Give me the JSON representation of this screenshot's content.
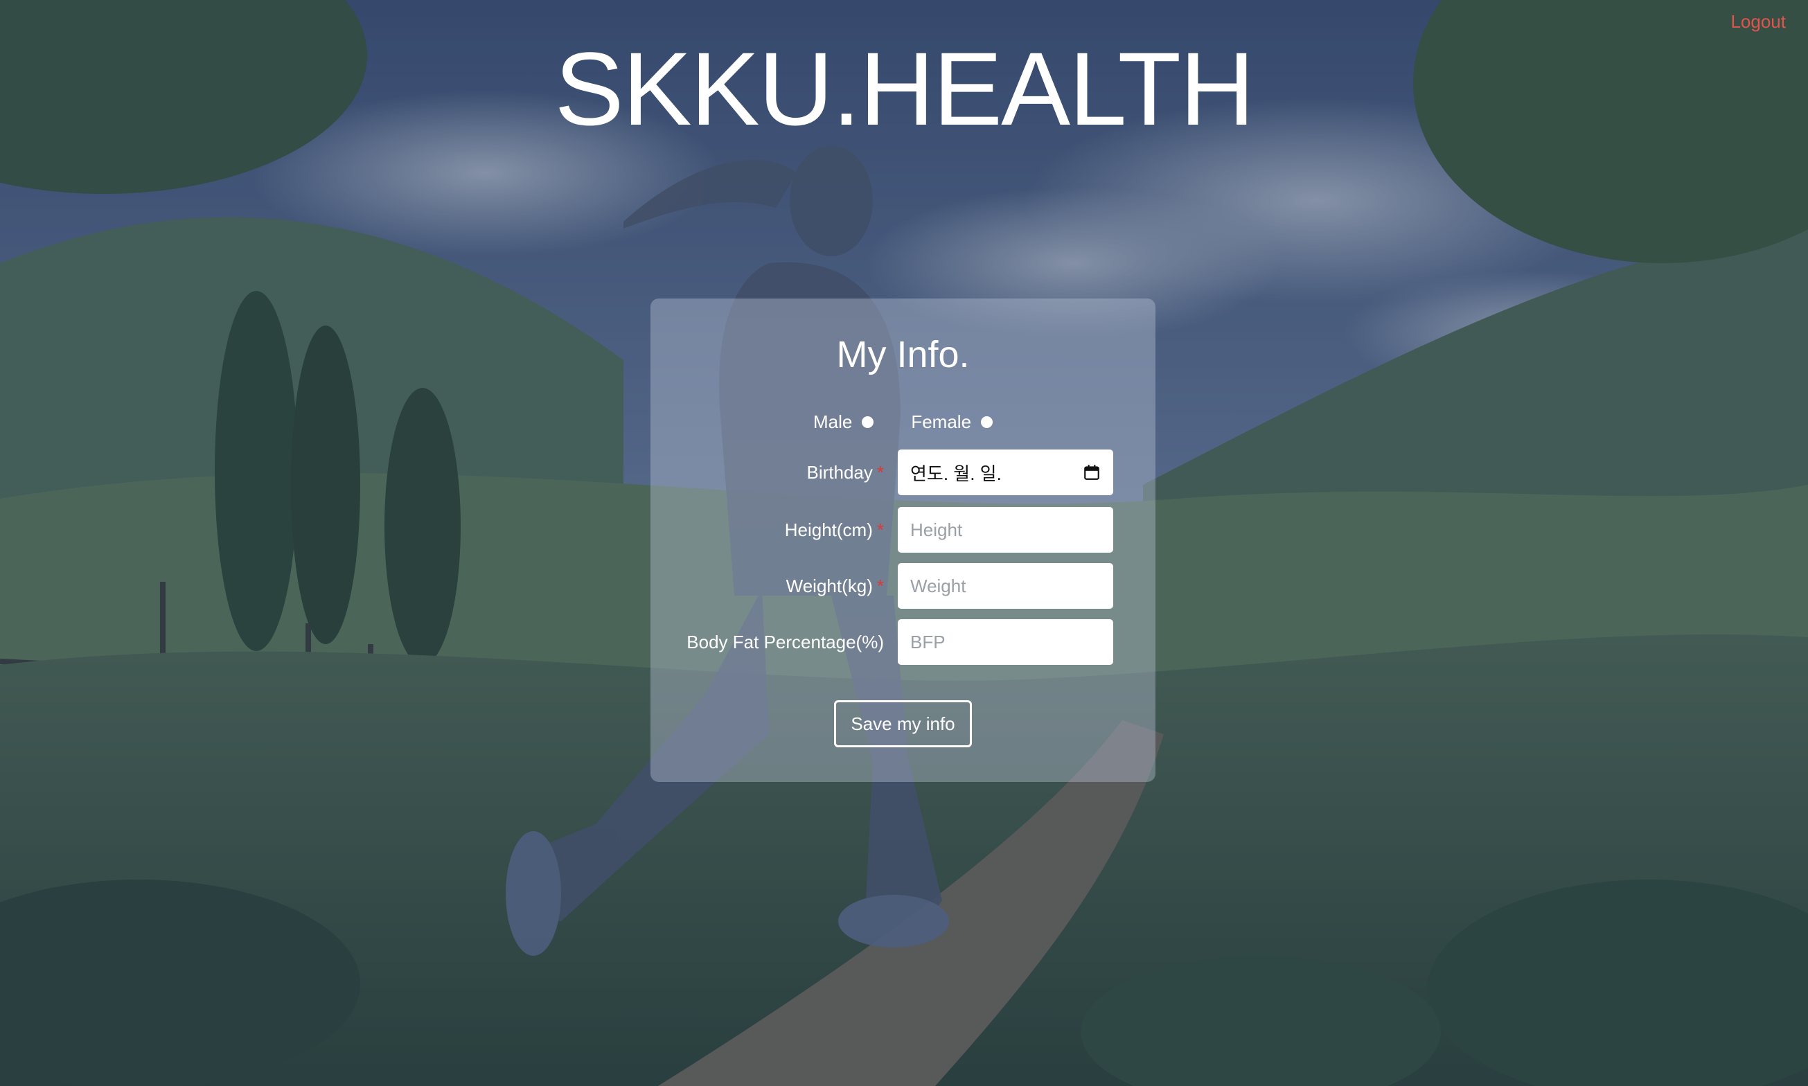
{
  "header": {
    "logout_label": "Logout",
    "site_title": "SKKU.HEALTH"
  },
  "form": {
    "title": "My Info.",
    "gender": {
      "male_label": "Male",
      "female_label": "Female"
    },
    "birthday": {
      "label": "Birthday",
      "required_mark": "*",
      "value": "연도. 월. 일."
    },
    "height": {
      "label": "Height(cm)",
      "required_mark": "*",
      "placeholder": "Height"
    },
    "weight": {
      "label": "Weight(kg)",
      "required_mark": "*",
      "placeholder": "Weight"
    },
    "bfp": {
      "label": "Body Fat Percentage(%)",
      "placeholder": "BFP"
    },
    "save_label": "Save my info"
  },
  "colors": {
    "logout": "#e2534b",
    "required": "#d93a3a",
    "title_text": "#ffffff"
  },
  "icons": {
    "calendar": "calendar-icon",
    "background": "runner-in-meadow-illustration"
  }
}
